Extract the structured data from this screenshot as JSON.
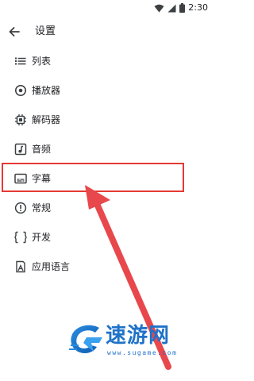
{
  "status_bar": {
    "time": "2:30"
  },
  "header": {
    "title": "设置"
  },
  "menu": {
    "items": [
      {
        "label": "列表",
        "icon": "list-icon"
      },
      {
        "label": "播放器",
        "icon": "play-circle-icon"
      },
      {
        "label": "解码器",
        "icon": "chip-icon"
      },
      {
        "label": "音频",
        "icon": "music-note-icon"
      },
      {
        "label": "字幕",
        "icon": "subtitles-icon"
      },
      {
        "label": "常规",
        "icon": "info-icon"
      },
      {
        "label": "开发",
        "icon": "developer-icon"
      },
      {
        "label": "应用语言",
        "icon": "language-icon"
      }
    ]
  },
  "annotation": {
    "highlighted_item": "字幕",
    "color": "#e53935"
  },
  "watermark": {
    "name": "速游网",
    "url": "www.sugame.com"
  },
  "colors": {
    "text": "#202124",
    "icon": "#3c4043",
    "annotation": "#e53935",
    "watermark": "#1f72c9"
  }
}
